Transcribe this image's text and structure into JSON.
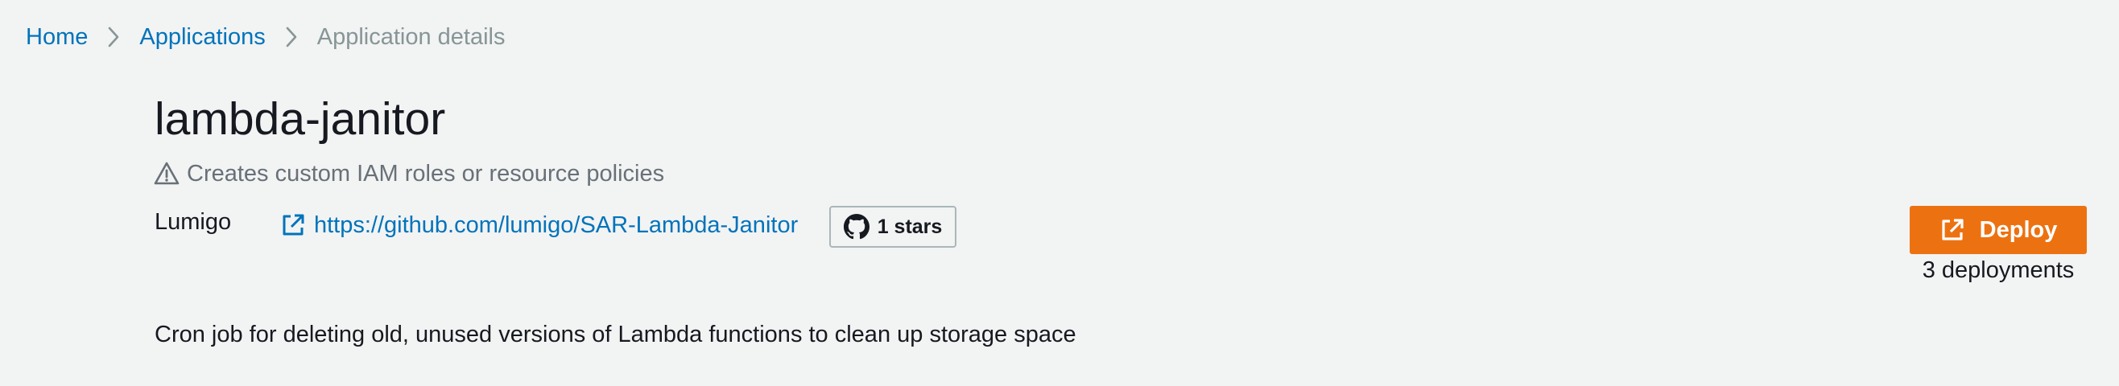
{
  "breadcrumb": {
    "home": "Home",
    "applications": "Applications",
    "current": "Application details"
  },
  "app": {
    "name": "lambda-janitor",
    "warning": "Creates custom IAM roles or resource policies",
    "publisher": "Lumigo",
    "repo_url": "https://github.com/lumigo/SAR-Lambda-Janitor",
    "stars_label": "1 stars",
    "description": "Cron job for deleting old, unused versions of Lambda functions to clean up storage space"
  },
  "deploy": {
    "label": "Deploy",
    "count_label": "3 deployments"
  },
  "icons": {
    "breadcrumb_separator": "chevron-right-icon",
    "warning": "warning-triangle-icon",
    "external_link": "external-link-icon",
    "github": "github-icon",
    "deploy": "external-link-icon"
  },
  "colors": {
    "link": "#0073bb",
    "primary_button": "#ec7211",
    "background": "#f2f3f3",
    "muted_text": "#687078"
  }
}
